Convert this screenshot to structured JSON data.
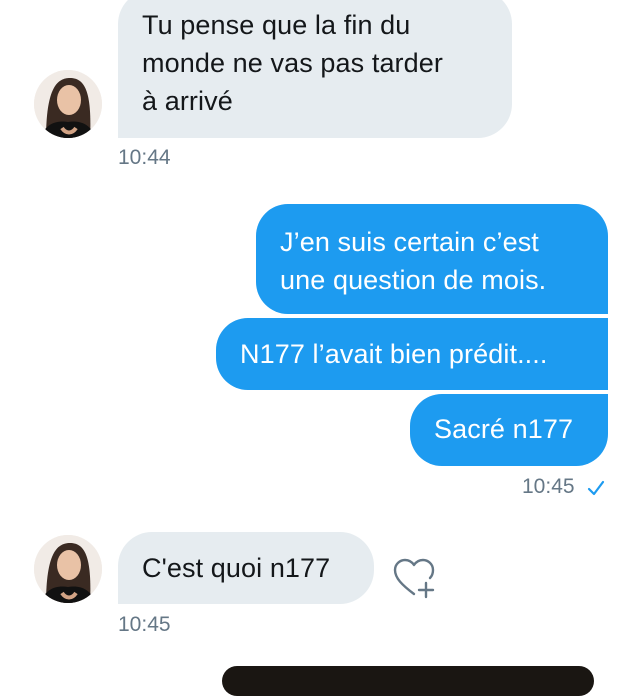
{
  "conversation": {
    "incoming_1": {
      "lines": [
        "Tu pense que la fin du",
        "monde ne vas pas tarder",
        "à arrivé"
      ],
      "time": "10:44"
    },
    "outgoing": {
      "messages": [
        {
          "lines": [
            "J’en suis certain c’est",
            "une question de mois."
          ]
        },
        {
          "lines": [
            "N177 l’avait bien prédit...."
          ]
        },
        {
          "lines": [
            "Sacré n177"
          ]
        }
      ],
      "time": "10:45",
      "status_icon": "read-check-icon"
    },
    "incoming_2": {
      "text": "C'est quoi n177",
      "time": "10:45",
      "action_icon": "heart-plus-icon"
    }
  },
  "colors": {
    "incoming_bubble": "#e6ecf0",
    "outgoing_bubble": "#1d9bf0",
    "timestamp": "#657786",
    "icon_stroke": "#657786",
    "check": "#1d9bf0"
  }
}
